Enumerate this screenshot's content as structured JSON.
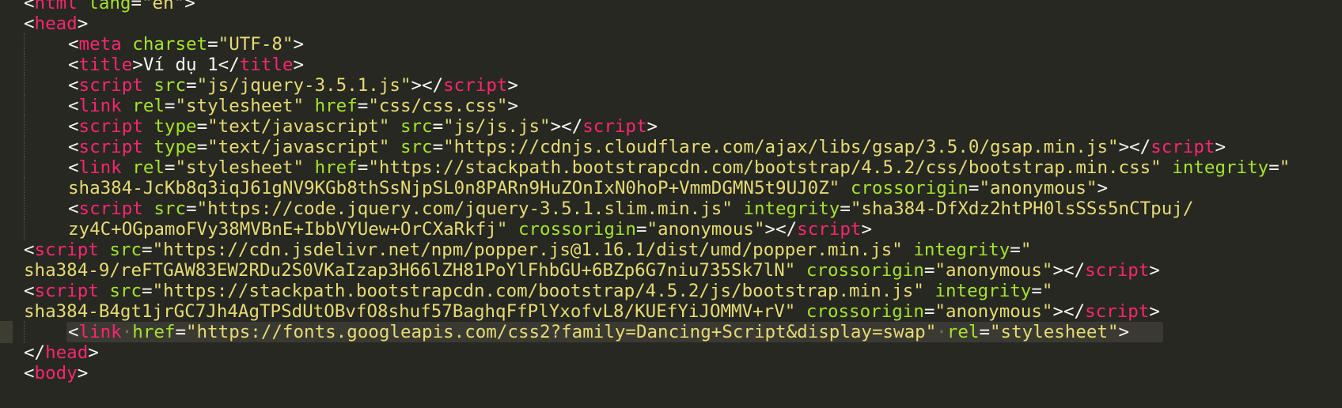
{
  "colors": {
    "background": "#272822",
    "tag": "#f92672",
    "attribute": "#a6e22e",
    "string": "#e6db74",
    "punctuation": "#f8f8f2"
  },
  "lines": [
    {
      "indent": false,
      "tokens": [
        [
          "p",
          "<"
        ],
        [
          "t",
          "html"
        ],
        [
          "p",
          " "
        ],
        [
          "a",
          "lang"
        ],
        [
          "p",
          "="
        ],
        [
          "s",
          "\"en\""
        ],
        [
          "p",
          ">"
        ]
      ]
    },
    {
      "indent": false,
      "tokens": [
        [
          "p",
          "<"
        ],
        [
          "t",
          "head"
        ],
        [
          "p",
          ">"
        ]
      ]
    },
    {
      "indent": true,
      "tokens": [
        [
          "p",
          "<"
        ],
        [
          "t",
          "meta"
        ],
        [
          "p",
          " "
        ],
        [
          "a",
          "charset"
        ],
        [
          "p",
          "="
        ],
        [
          "s",
          "\"UTF-8\""
        ],
        [
          "p",
          ">"
        ]
      ]
    },
    {
      "indent": true,
      "tokens": [
        [
          "p",
          "<"
        ],
        [
          "t",
          "title"
        ],
        [
          "p",
          ">Ví dụ 1</"
        ],
        [
          "t",
          "title"
        ],
        [
          "p",
          ">"
        ]
      ]
    },
    {
      "indent": true,
      "tokens": [
        [
          "p",
          "<"
        ],
        [
          "t",
          "script"
        ],
        [
          "p",
          " "
        ],
        [
          "a",
          "src"
        ],
        [
          "p",
          "="
        ],
        [
          "s",
          "\"js/jquery-3.5.1.js\""
        ],
        [
          "p",
          "></"
        ],
        [
          "t",
          "script"
        ],
        [
          "p",
          ">"
        ]
      ]
    },
    {
      "indent": true,
      "tokens": [
        [
          "p",
          "<"
        ],
        [
          "t",
          "link"
        ],
        [
          "p",
          " "
        ],
        [
          "a",
          "rel"
        ],
        [
          "p",
          "="
        ],
        [
          "s",
          "\"stylesheet\""
        ],
        [
          "p",
          " "
        ],
        [
          "a",
          "href"
        ],
        [
          "p",
          "="
        ],
        [
          "s",
          "\"css/css.css\""
        ],
        [
          "p",
          ">"
        ]
      ]
    },
    {
      "indent": true,
      "tokens": [
        [
          "p",
          "<"
        ],
        [
          "t",
          "script"
        ],
        [
          "p",
          " "
        ],
        [
          "a",
          "type"
        ],
        [
          "p",
          "="
        ],
        [
          "s",
          "\"text/javascript\""
        ],
        [
          "p",
          " "
        ],
        [
          "a",
          "src"
        ],
        [
          "p",
          "="
        ],
        [
          "s",
          "\"js/js.js\""
        ],
        [
          "p",
          "></"
        ],
        [
          "t",
          "script"
        ],
        [
          "p",
          ">"
        ]
      ]
    },
    {
      "indent": true,
      "tokens": [
        [
          "p",
          "<"
        ],
        [
          "t",
          "script"
        ],
        [
          "p",
          " "
        ],
        [
          "a",
          "type"
        ],
        [
          "p",
          "="
        ],
        [
          "s",
          "\"text/javascript\""
        ],
        [
          "p",
          " "
        ],
        [
          "a",
          "src"
        ],
        [
          "p",
          "="
        ],
        [
          "s",
          "\"https://cdnjs.cloudflare.com/ajax/libs/gsap/3.5.0/gsap.min.js\""
        ],
        [
          "p",
          "></"
        ],
        [
          "t",
          "script"
        ],
        [
          "p",
          ">"
        ]
      ]
    },
    {
      "indent": true,
      "tokens": [
        [
          "p",
          "<"
        ],
        [
          "t",
          "link"
        ],
        [
          "p",
          " "
        ],
        [
          "a",
          "rel"
        ],
        [
          "p",
          "="
        ],
        [
          "s",
          "\"stylesheet\""
        ],
        [
          "p",
          " "
        ],
        [
          "a",
          "href"
        ],
        [
          "p",
          "="
        ],
        [
          "s",
          "\"https://stackpath.bootstrapcdn.com/bootstrap/4.5.2/css/bootstrap.min.css\""
        ],
        [
          "p",
          " "
        ],
        [
          "a",
          "integrity"
        ],
        [
          "p",
          "="
        ],
        [
          "s",
          "\""
        ]
      ]
    },
    {
      "indent": true,
      "tokens": [
        [
          "s",
          "sha384-JcKb8q3iqJ61gNV9KGb8thSsNjpSL0n8PARn9HuZOnIxN0hoP+VmmDGMN5t9UJ0Z\""
        ],
        [
          "p",
          " "
        ],
        [
          "a",
          "crossorigin"
        ],
        [
          "p",
          "="
        ],
        [
          "s",
          "\"anonymous\""
        ],
        [
          "p",
          ">"
        ]
      ]
    },
    {
      "indent": true,
      "tokens": [
        [
          "p",
          "<"
        ],
        [
          "t",
          "script"
        ],
        [
          "p",
          " "
        ],
        [
          "a",
          "src"
        ],
        [
          "p",
          "="
        ],
        [
          "s",
          "\"https://code.jquery.com/jquery-3.5.1.slim.min.js\""
        ],
        [
          "p",
          " "
        ],
        [
          "a",
          "integrity"
        ],
        [
          "p",
          "="
        ],
        [
          "s",
          "\"sha384-DfXdz2htPH0lsSSs5nCTpuj/"
        ]
      ]
    },
    {
      "indent": true,
      "tokens": [
        [
          "s",
          "zy4C+OGpamoFVy38MVBnE+IbbVYUew+OrCXaRkfj\""
        ],
        [
          "p",
          " "
        ],
        [
          "a",
          "crossorigin"
        ],
        [
          "p",
          "="
        ],
        [
          "s",
          "\"anonymous\""
        ],
        [
          "p",
          "></"
        ],
        [
          "t",
          "script"
        ],
        [
          "p",
          ">"
        ]
      ]
    },
    {
      "indent": false,
      "tokens": [
        [
          "p",
          "<"
        ],
        [
          "t",
          "script"
        ],
        [
          "p",
          " "
        ],
        [
          "a",
          "src"
        ],
        [
          "p",
          "="
        ],
        [
          "s",
          "\"https://cdn.jsdelivr.net/npm/popper.js@1.16.1/dist/umd/popper.min.js\""
        ],
        [
          "p",
          " "
        ],
        [
          "a",
          "integrity"
        ],
        [
          "p",
          "="
        ],
        [
          "s",
          "\""
        ]
      ]
    },
    {
      "indent": false,
      "tokens": [
        [
          "s",
          "sha384-9/reFTGAW83EW2RDu2S0VKaIzap3H66lZH81PoYlFhbGU+6BZp6G7niu735Sk7lN\""
        ],
        [
          "p",
          " "
        ],
        [
          "a",
          "crossorigin"
        ],
        [
          "p",
          "="
        ],
        [
          "s",
          "\"anonymous\""
        ],
        [
          "p",
          "></"
        ],
        [
          "t",
          "script"
        ],
        [
          "p",
          ">"
        ]
      ]
    },
    {
      "indent": false,
      "tokens": [
        [
          "p",
          "<"
        ],
        [
          "t",
          "script"
        ],
        [
          "p",
          " "
        ],
        [
          "a",
          "src"
        ],
        [
          "p",
          "="
        ],
        [
          "s",
          "\"https://stackpath.bootstrapcdn.com/bootstrap/4.5.2/js/bootstrap.min.js\""
        ],
        [
          "p",
          " "
        ],
        [
          "a",
          "integrity"
        ],
        [
          "p",
          "="
        ],
        [
          "s",
          "\""
        ]
      ]
    },
    {
      "indent": false,
      "tokens": [
        [
          "s",
          "sha384-B4gt1jrGC7Jh4AgTPSdUtOBvfO8shuf57BaghqFfPlYxofvL8/KUEfYiJOMMV+rV\""
        ],
        [
          "p",
          " "
        ],
        [
          "a",
          "crossorigin"
        ],
        [
          "p",
          "="
        ],
        [
          "s",
          "\"anonymous\""
        ],
        [
          "p",
          "></"
        ],
        [
          "t",
          "script"
        ],
        [
          "p",
          ">"
        ]
      ]
    },
    {
      "indent": true,
      "current": true,
      "tokens": [
        [
          "p",
          "<"
        ],
        [
          "t",
          "link"
        ],
        [
          "ws",
          "·"
        ],
        [
          "a",
          "href"
        ],
        [
          "p",
          "="
        ],
        [
          "s",
          "\"https://fonts.googleapis.com/css2?family=Dancing+Script&display=swap\""
        ],
        [
          "ws",
          "·"
        ],
        [
          "a",
          "rel"
        ],
        [
          "p",
          "="
        ],
        [
          "s",
          "\"stylesheet\""
        ],
        [
          "p",
          ">"
        ]
      ]
    },
    {
      "indent": false,
      "tokens": [
        [
          "p",
          "</"
        ],
        [
          "t",
          "head"
        ],
        [
          "p",
          ">"
        ]
      ]
    },
    {
      "indent": false,
      "tokens": [
        [
          "p",
          "<"
        ],
        [
          "t",
          "body"
        ],
        [
          "p",
          ">"
        ]
      ]
    }
  ]
}
